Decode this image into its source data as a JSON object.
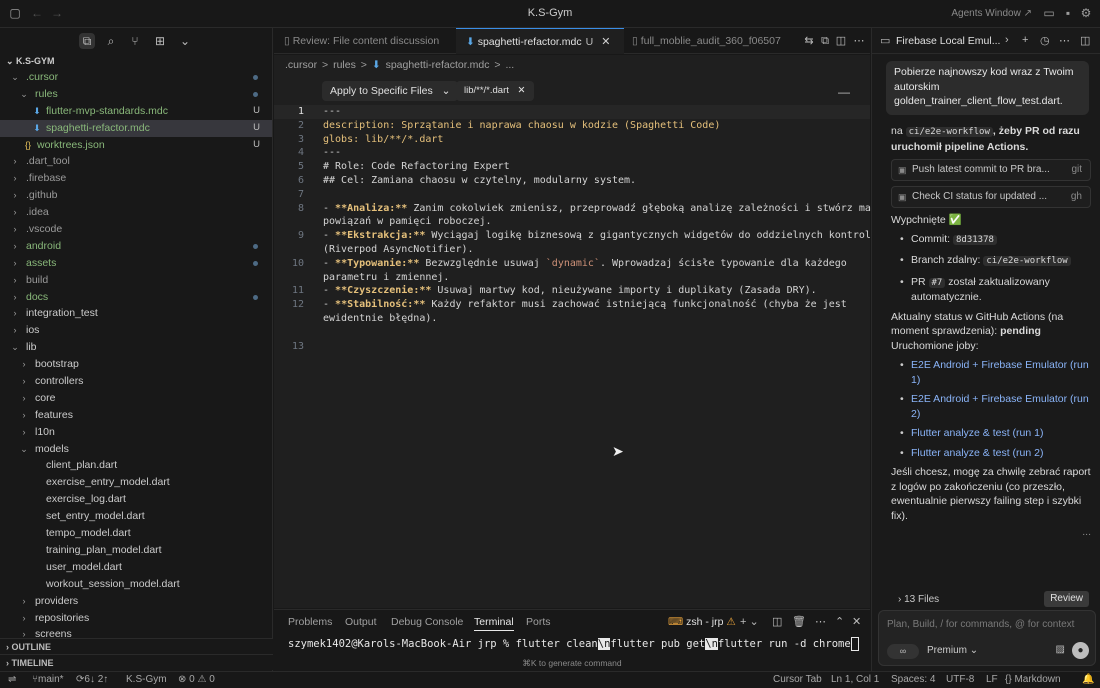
{
  "window": {
    "title": "K.S-Gym",
    "agents_window": "Agents Window ↗"
  },
  "explorer": {
    "header": "K.S-GYM",
    "items": [
      {
        "label": ".cursor",
        "type": "folder-open",
        "depth": 0,
        "color": "green",
        "dot": true
      },
      {
        "label": "rules",
        "type": "folder-open",
        "depth": 1,
        "color": "green",
        "dot": true
      },
      {
        "label": "flutter-mvp-standards.mdc",
        "type": "md",
        "depth": 2,
        "color": "green",
        "badge": "U"
      },
      {
        "label": "spaghetti-refactor.mdc",
        "type": "md",
        "depth": 2,
        "color": "green",
        "badge": "U",
        "selected": true
      },
      {
        "label": "worktrees.json",
        "type": "json",
        "depth": 1,
        "color": "green",
        "badge": "U"
      },
      {
        "label": ".dart_tool",
        "type": "folder",
        "depth": 0,
        "color": "dim"
      },
      {
        "label": ".firebase",
        "type": "folder",
        "depth": 0,
        "color": "dim"
      },
      {
        "label": ".github",
        "type": "folder",
        "depth": 0,
        "color": "dim"
      },
      {
        "label": ".idea",
        "type": "folder",
        "depth": 0,
        "color": "dim"
      },
      {
        "label": ".vscode",
        "type": "folder",
        "depth": 0,
        "color": "dim"
      },
      {
        "label": "android",
        "type": "folder",
        "depth": 0,
        "color": "green",
        "dot": true
      },
      {
        "label": "assets",
        "type": "folder",
        "depth": 0,
        "color": "green",
        "dot": true
      },
      {
        "label": "build",
        "type": "folder",
        "depth": 0,
        "color": "dim"
      },
      {
        "label": "docs",
        "type": "folder",
        "depth": 0,
        "color": "green",
        "dot": true
      },
      {
        "label": "integration_test",
        "type": "folder",
        "depth": 0,
        "color": "normal"
      },
      {
        "label": "ios",
        "type": "folder",
        "depth": 0,
        "color": "normal"
      },
      {
        "label": "lib",
        "type": "folder-open",
        "depth": 0,
        "color": "normal"
      },
      {
        "label": "bootstrap",
        "type": "folder",
        "depth": 1,
        "color": "normal"
      },
      {
        "label": "controllers",
        "type": "folder",
        "depth": 1,
        "color": "normal"
      },
      {
        "label": "core",
        "type": "folder",
        "depth": 1,
        "color": "normal"
      },
      {
        "label": "features",
        "type": "folder",
        "depth": 1,
        "color": "normal"
      },
      {
        "label": "l10n",
        "type": "folder",
        "depth": 1,
        "color": "normal"
      },
      {
        "label": "models",
        "type": "folder-open",
        "depth": 1,
        "color": "normal"
      },
      {
        "label": "client_plan.dart",
        "type": "dart",
        "depth": 2,
        "color": "normal"
      },
      {
        "label": "exercise_entry_model.dart",
        "type": "dart",
        "depth": 2,
        "color": "normal"
      },
      {
        "label": "exercise_log.dart",
        "type": "dart",
        "depth": 2,
        "color": "normal"
      },
      {
        "label": "set_entry_model.dart",
        "type": "dart",
        "depth": 2,
        "color": "normal"
      },
      {
        "label": "tempo_model.dart",
        "type": "dart",
        "depth": 2,
        "color": "normal"
      },
      {
        "label": "training_plan_model.dart",
        "type": "dart",
        "depth": 2,
        "color": "normal"
      },
      {
        "label": "user_model.dart",
        "type": "dart",
        "depth": 2,
        "color": "normal"
      },
      {
        "label": "workout_session_model.dart",
        "type": "dart",
        "depth": 2,
        "color": "normal"
      },
      {
        "label": "providers",
        "type": "folder",
        "depth": 1,
        "color": "normal"
      },
      {
        "label": "repositories",
        "type": "folder",
        "depth": 1,
        "color": "normal"
      },
      {
        "label": "screens",
        "type": "folder",
        "depth": 1,
        "color": "normal"
      }
    ],
    "outline": "OUTLINE",
    "timeline": "TIMELINE"
  },
  "tabs": [
    {
      "label": "Review: File content discussion",
      "active": false
    },
    {
      "label": "spaghetti-refactor.mdc",
      "active": true,
      "badge": "U"
    },
    {
      "label": "full_moblie_audit_360_f06507",
      "active": false
    }
  ],
  "breadcrumb": [
    ".cursor",
    ">",
    "rules",
    ">",
    "spaghetti-refactor.mdc",
    ">",
    "..."
  ],
  "editor": {
    "apply_label": "Apply to Specific Files",
    "glob_chip": "lib/**/*.dart",
    "lines": [
      {
        "n": "1",
        "segs": [
          {
            "t": "---",
            "c": ""
          }
        ]
      },
      {
        "n": "2",
        "segs": [
          {
            "t": "description: Sprzątanie i naprawa chaosu w kodzie (Spaghetti Code)",
            "c": "k-yel"
          }
        ]
      },
      {
        "n": "3",
        "segs": [
          {
            "t": "globs: lib/**/*.dart",
            "c": "k-yel"
          }
        ]
      },
      {
        "n": "4",
        "segs": [
          {
            "t": "---",
            "c": ""
          }
        ]
      },
      {
        "n": "5",
        "segs": [
          {
            "t": "# Role: Code Refactoring Expert",
            "c": ""
          }
        ]
      },
      {
        "n": "6",
        "segs": [
          {
            "t": "## Cel: Zamiana chaosu w czytelny, modularny system.",
            "c": ""
          }
        ]
      },
      {
        "n": "7",
        "segs": [
          {
            "t": "",
            "c": ""
          }
        ]
      },
      {
        "n": "8",
        "segs": [
          {
            "t": "- ",
            "c": ""
          },
          {
            "t": "**Analiza:**",
            "c": "k-bold"
          },
          {
            "t": " Zanim cokolwiek zmienisz, przeprowadź głęboką analizę zależności i stwórz mapę",
            "c": ""
          }
        ]
      },
      {
        "n": "",
        "segs": [
          {
            "t": "powiązań w pamięci roboczej.",
            "c": ""
          }
        ]
      },
      {
        "n": "9",
        "segs": [
          {
            "t": "- ",
            "c": ""
          },
          {
            "t": "**Ekstrakcja:**",
            "c": "k-bold"
          },
          {
            "t": " Wyciągaj logikę biznesową z gigantycznych widgetów do oddzielnych kontrolerów",
            "c": ""
          }
        ]
      },
      {
        "n": "",
        "segs": [
          {
            "t": "(Riverpod AsyncNotifier).",
            "c": ""
          }
        ]
      },
      {
        "n": "10",
        "segs": [
          {
            "t": "- ",
            "c": ""
          },
          {
            "t": "**Typowanie:**",
            "c": "k-bold"
          },
          {
            "t": " Bezwzględnie usuwaj ",
            "c": ""
          },
          {
            "t": "`dynamic`",
            "c": "k-code"
          },
          {
            "t": ". Wprowadzaj ścisłe typowanie dla każdego",
            "c": ""
          }
        ]
      },
      {
        "n": "",
        "segs": [
          {
            "t": "parametru i zmiennej.",
            "c": ""
          }
        ]
      },
      {
        "n": "11",
        "segs": [
          {
            "t": "- ",
            "c": ""
          },
          {
            "t": "**Czyszczenie:**",
            "c": "k-bold"
          },
          {
            "t": " Usuwaj martwy kod, nieużywane importy i duplikaty (Zasada DRY).",
            "c": ""
          }
        ]
      },
      {
        "n": "12",
        "segs": [
          {
            "t": "- ",
            "c": ""
          },
          {
            "t": "**Stabilność:**",
            "c": "k-bold"
          },
          {
            "t": " Każdy refaktor musi zachować istniejącą funkcjonalność (chyba że jest",
            "c": ""
          }
        ]
      },
      {
        "n": "",
        "segs": [
          {
            "t": "ewidentnie błędna).",
            "c": ""
          }
        ]
      },
      {
        "n": "",
        "segs": [
          {
            "t": "",
            "c": ""
          }
        ]
      },
      {
        "n": "13",
        "segs": [
          {
            "t": "",
            "c": ""
          }
        ]
      }
    ]
  },
  "panel": {
    "tabs": [
      "Problems",
      "Output",
      "Debug Console",
      "Terminal",
      "Ports"
    ],
    "active_tab": "Terminal",
    "terminal_name": "zsh - jrp",
    "prompt": "szymek1402@Karols-MacBook-Air jrp % ",
    "cmd_parts": [
      "flutter clean",
      "\\n",
      "flutter pub get",
      "\\n",
      "flutter run -d chrome"
    ],
    "hint": "⌘K to generate command"
  },
  "chat": {
    "title": "Firebase Local Emul...",
    "user_message": "Pobierze najnowszy kod wraz z Twoim autorskim golden_trainer_client_flow_test.dart.",
    "partial_prefix": "na ",
    "partial_code": "ci/e2e-workflow",
    "partial_suffix": ", żeby PR od razu uruchomił pipeline Actions.",
    "tool_calls": [
      {
        "label": "Push latest commit to PR bra...",
        "tag": "git"
      },
      {
        "label": "Check CI status for updated ...",
        "tag": "gh"
      }
    ],
    "pushed": "Wypchnięte ✅",
    "commit_label": "Commit: ",
    "commit_value": "8d31378",
    "branch_label": "Branch zdalny: ",
    "branch_value": "ci/e2e-workflow",
    "pr_prefix": "PR ",
    "pr_value": "#7",
    "pr_suffix": " został zaktualizowany automatycznie.",
    "status_line": "Aktualny status w GitHub Actions (na moment sprawdzenia): ",
    "status_value": "pending",
    "jobs_label": "Uruchomione joby:",
    "jobs": [
      "E2E Android + Firebase Emulator (run 1)",
      "E2E Android + Firebase Emulator (run 2)",
      "Flutter analyze & test (run 1)",
      "Flutter analyze & test (run 2)"
    ],
    "closing": "Jeśli chcesz, mogę za chwilę zebrać raport z logów po zakończeniu (co przeszło, ewentualnie pierwszy failing step i szybki fix).",
    "more": "...",
    "files_label": "13 Files",
    "review_label": "Review",
    "placeholder": "Plan, Build, / for commands, @ for context",
    "mode_glyph": "∞",
    "model": "Premium ⌄"
  },
  "status": {
    "branch": "main*",
    "sync": "6↓ 2↑",
    "project": "K.S-Gym",
    "problems": "⊗ 0 ⚠ 0",
    "cursor_tab": "Cursor Tab",
    "position": "Ln 1, Col 1",
    "spaces": "Spaces: 4",
    "encoding": "UTF-8",
    "eol": "LF",
    "language": "{} Markdown"
  }
}
